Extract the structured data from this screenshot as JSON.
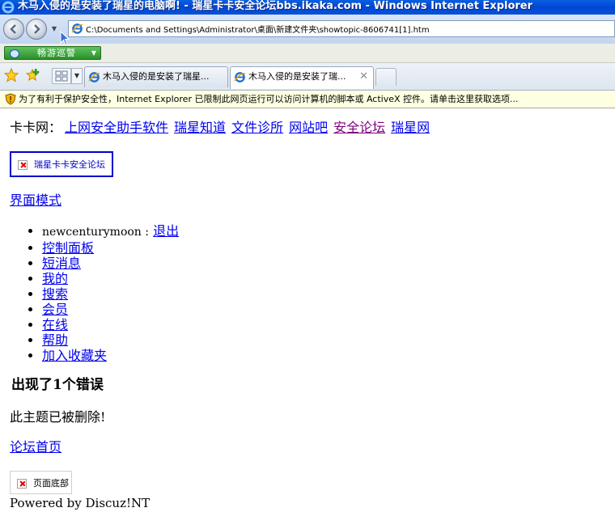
{
  "window": {
    "title": "木马入侵的是安装了瑞星的电脑啊! - 瑞星卡卡安全论坛bbs.ikaka.com - Windows Internet Explorer"
  },
  "address_bar": {
    "url": "C:\\Documents and Settings\\Administrator\\桌面\\新建文件夹\\showtopic-8606741[1].htm"
  },
  "toolbar": {
    "green_button_label": "畅游巡警"
  },
  "tabs": [
    {
      "label": "木马入侵的是安装了瑞星...",
      "active": false
    },
    {
      "label": "木马入侵的是安装了瑞...",
      "active": true
    }
  ],
  "infobar": {
    "text": "为了有利于保护安全性，Internet Explorer 已限制此网页运行可以访问计算机的脚本或 ActiveX 控件。请单击这里获取选项..."
  },
  "page": {
    "nav": {
      "prefix": "卡卡网：",
      "links": [
        "上网安全助手软件",
        "瑞星知道",
        "文件诊所",
        "网站吧",
        "安全论坛",
        "瑞星网"
      ]
    },
    "logo_alt": "瑞星卡卡安全论坛",
    "mode_link": "界面模式",
    "user": {
      "name": "newcenturymoon :",
      "logout": "退出"
    },
    "menu_items": [
      "控制面板",
      "短消息",
      "我的",
      "搜索",
      "会员",
      "在线",
      "帮助",
      "加入收藏夹"
    ],
    "error_title": "出现了1个错误",
    "error_message": "此主题已被删除!",
    "home_link": "论坛首页",
    "footer_alt": "页面底部",
    "powered_by": "Powered by Discuz!NT"
  },
  "colors": {
    "link": "#0000ee",
    "visited_link": "#800080",
    "titlebar": "#0046d5",
    "infobar_bg": "#ffffe1"
  }
}
